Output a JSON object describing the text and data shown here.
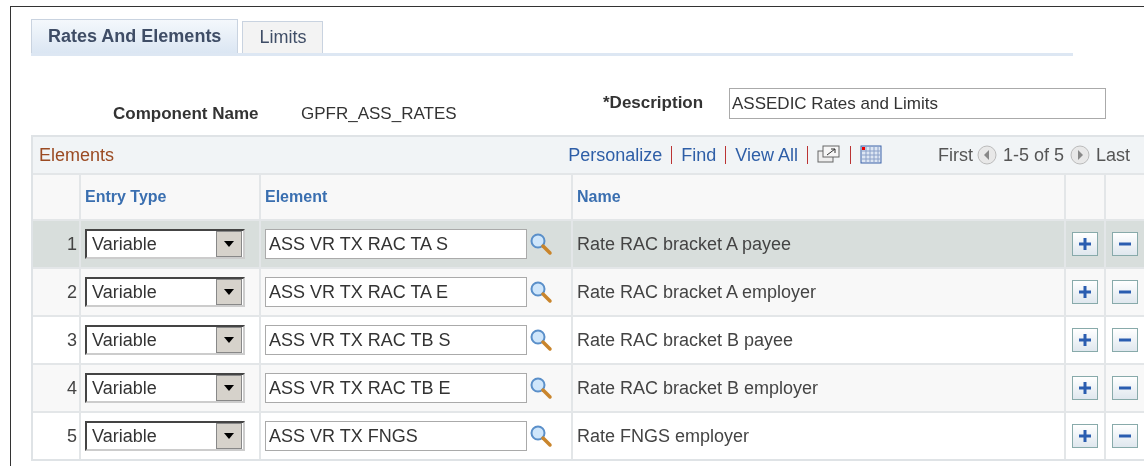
{
  "tabs": [
    {
      "label": "Rates And Elements",
      "selected": true
    },
    {
      "label": "Limits",
      "selected": false
    }
  ],
  "component": {
    "label": "Component Name",
    "value": "GPFR_ASS_RATES"
  },
  "description": {
    "label": "*Description",
    "value": "ASSEDIC Rates and Limits"
  },
  "grid": {
    "title": "Elements",
    "links": [
      "Personalize",
      "Find",
      "View All"
    ],
    "first": "First",
    "range": "1-5 of 5",
    "last": "Last",
    "columns": [
      "Entry Type",
      "Element",
      "Name"
    ],
    "rows": [
      {
        "number": "1",
        "entry_type": "Variable",
        "element": "ASS VR TX RAC TA S",
        "name": "Rate RAC bracket A payee",
        "selected": true
      },
      {
        "number": "2",
        "entry_type": "Variable",
        "element": "ASS VR TX RAC TA E",
        "name": "Rate RAC bracket A employer",
        "selected": false
      },
      {
        "number": "3",
        "entry_type": "Variable",
        "element": "ASS VR TX RAC TB S",
        "name": "Rate RAC bracket B payee",
        "selected": false
      },
      {
        "number": "4",
        "entry_type": "Variable",
        "element": "ASS VR TX RAC TB E",
        "name": "Rate RAC bracket B employer",
        "selected": false
      },
      {
        "number": "5",
        "entry_type": "Variable",
        "element": "ASS VR TX FNGS",
        "name": "Rate FNGS employer",
        "selected": false
      }
    ]
  }
}
